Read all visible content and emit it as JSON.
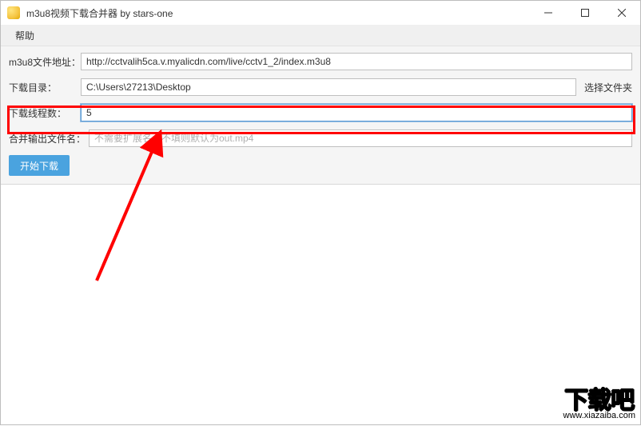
{
  "window": {
    "title": "m3u8视频下载合并器 by stars-one"
  },
  "menu": {
    "help": "帮助"
  },
  "form": {
    "url_label": "m3u8文件地址：",
    "url_value": "http://cctvalih5ca.v.myalicdn.com/live/cctv1_2/index.m3u8",
    "dir_label": "下载目录：",
    "dir_value": "C:\\Users\\27213\\Desktop",
    "dir_browse": "选择文件夹",
    "threads_label": "下载线程数：",
    "threads_value": "5",
    "output_label": "合并输出文件名：",
    "output_placeholder": "不需要扩展名，不填则默认为out.mp4",
    "start_button": "开始下载"
  },
  "watermark": {
    "main": "下载吧",
    "sub": "www.xiazaiba.com"
  }
}
